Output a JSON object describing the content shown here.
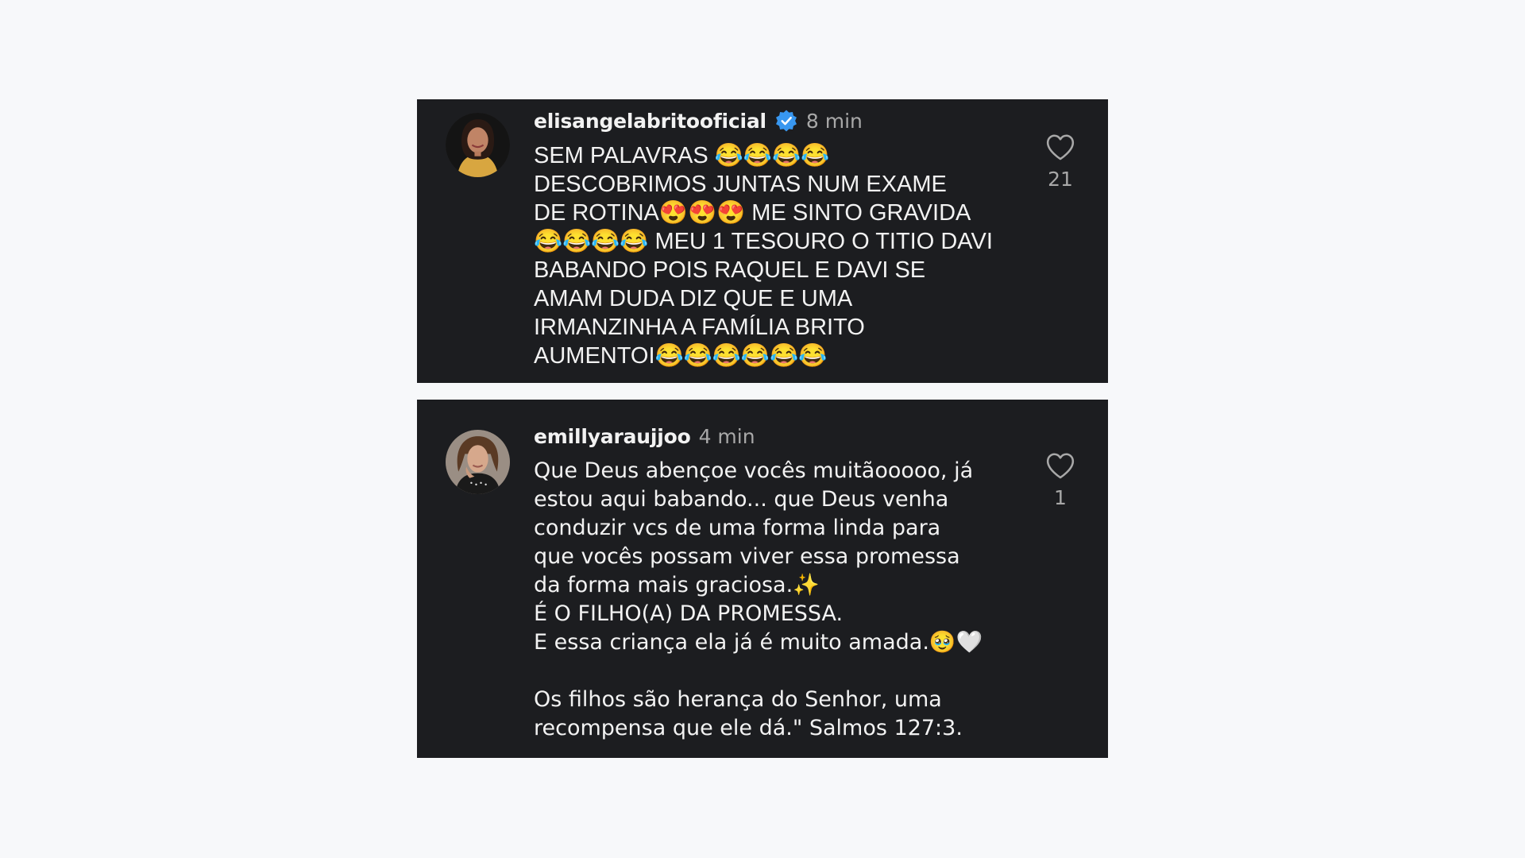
{
  "comments": [
    {
      "username": "elisangelabritooficial",
      "verified": true,
      "time": "8 min",
      "text": "SEM PALAVRAS 😂😂😂😂\nDESCOBRIMOS JUNTAS NUM EXAME\nDE ROTINA😍😍😍 ME SINTO GRAVIDA\n😂😂😂😂 MEU 1 TESOURO O TITIO DAVI\nBABANDO POIS RAQUEL E DAVI SE\nAMAM DUDA DIZ QUE E UMA\nIRMANZINHA A FAMÍLIA BRITO\nAUMENTOI😂😂😂😂😂😂",
      "likes": "21"
    },
    {
      "username": "emillyaraujjoo",
      "verified": false,
      "time": "4 min",
      "text": "Que Deus abençoe vocês muitãooooo, já\nestou aqui babando... que Deus venha\nconduzir vcs de uma forma linda para\nque vocês possam viver essa promessa\nda forma mais graciosa.✨\nÉ O FILHO(A) DA PROMESSA.\nE essa criança ela já é muito amada.🥹🤍\n\nOs filhos são herança do Senhor, uma\nrecompensa que ele dá.\" Salmos 127:3.",
      "likes": "1"
    }
  ],
  "colors": {
    "page_background": "#f7f8fa",
    "card_background": "#1c1d20",
    "primary_text": "#f2f2f2",
    "secondary_text": "#a8a8a8",
    "verified_badge": "#3897f0"
  },
  "icons": {
    "verified": "verified-badge-icon",
    "like": "heart-icon"
  }
}
